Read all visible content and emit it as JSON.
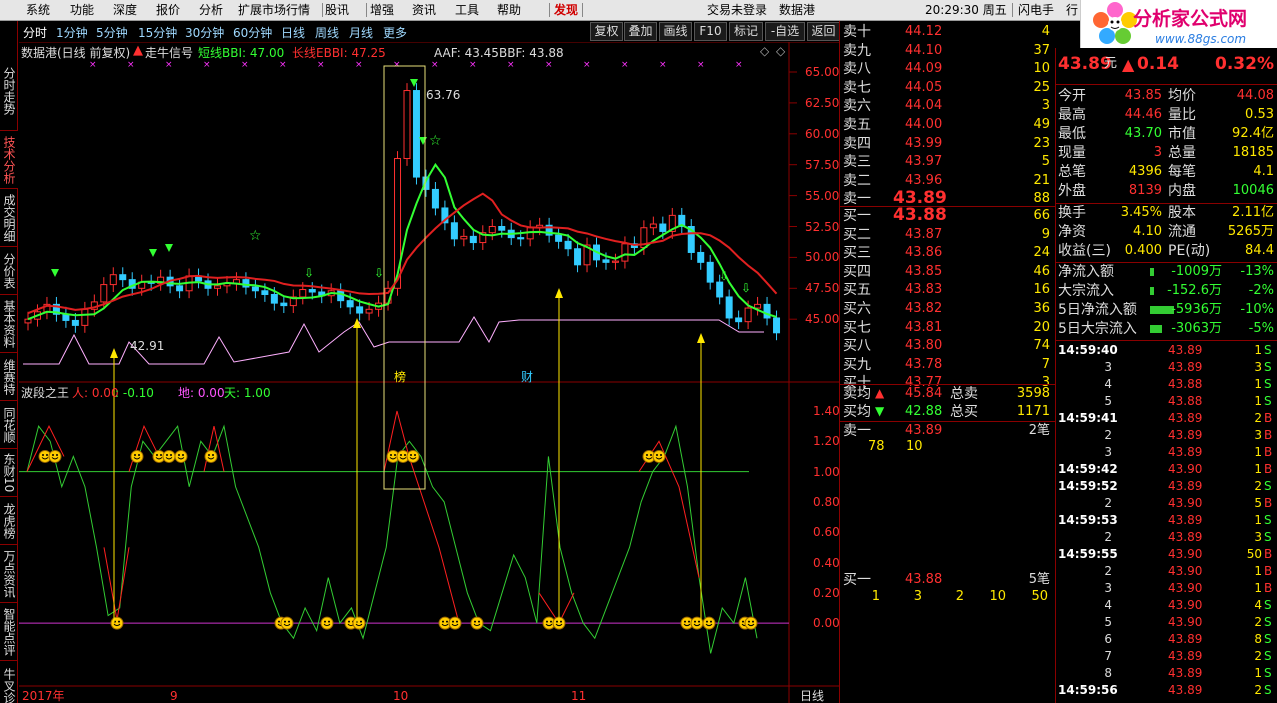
{
  "menu": [
    "系统",
    "功能",
    "深度",
    "报价",
    "分析",
    "扩展市场行情",
    "股讯",
    "增强",
    "资讯",
    "工具",
    "帮助",
    "发现"
  ],
  "status": {
    "login": "交易未登录",
    "stock": "数据港",
    "time": "20:29:30 周五",
    "flash": "闪电手",
    "more": "行"
  },
  "logo": {
    "text": "分析家公式网",
    "url": "www.88gs.com"
  },
  "leftnav": [
    "分时走势",
    "技术分析",
    "成交明细",
    "分价表",
    "基本资料",
    "维赛特",
    "同花顺",
    "东财10",
    "龙虎榜",
    "万点资讯",
    "智能点评",
    "牛叉诊股"
  ],
  "timeframes": [
    "分时",
    "1分钟",
    "5分钟",
    "15分钟",
    "30分钟",
    "60分钟",
    "日线",
    "周线",
    "月线",
    "更多"
  ],
  "toolbar": [
    "复权",
    "叠加",
    "画线",
    "F10",
    "标记",
    "-自选",
    "返回"
  ],
  "main_info": {
    "title": "数据港(日线 前复权)",
    "signal": "走牛信号",
    "short_bbi": "短线BBI: 47.00",
    "long_bbi": "长线EBBI: 47.25",
    "aaf": "AAF: 43.45",
    "bbf": "BBF: 43.88"
  },
  "price_axis": [
    "65.00",
    "62.50",
    "60.00",
    "57.50",
    "55.00",
    "52.50",
    "50.00",
    "47.50",
    "45.00"
  ],
  "annotations": {
    "high": "63.76",
    "low": "42.91",
    "bang": "榜",
    "cai": "财"
  },
  "sub_info": {
    "title": "波段之王",
    "ren": "人: 0.00",
    "val2": ": -0.10",
    "di": "地: 0.00",
    "tian": "天: 1.00"
  },
  "sub_axis": [
    "1.40",
    "1.20",
    "1.00",
    "0.80",
    "0.60",
    "0.40",
    "0.20",
    "0.00"
  ],
  "date_axis": [
    "2017年",
    "9",
    "10",
    "11"
  ],
  "period_label": "日线",
  "order_book": {
    "asks": [
      {
        "label": "卖十",
        "price": "44.12",
        "vol": "4"
      },
      {
        "label": "卖九",
        "price": "44.10",
        "vol": "37"
      },
      {
        "label": "卖八",
        "price": "44.09",
        "vol": "10"
      },
      {
        "label": "卖七",
        "price": "44.05",
        "vol": "25"
      },
      {
        "label": "卖六",
        "price": "44.04",
        "vol": "3"
      },
      {
        "label": "卖五",
        "price": "44.00",
        "vol": "49"
      },
      {
        "label": "卖四",
        "price": "43.99",
        "vol": "23"
      },
      {
        "label": "卖三",
        "price": "43.97",
        "vol": "5"
      },
      {
        "label": "卖二",
        "price": "43.96",
        "vol": "21"
      },
      {
        "label": "卖一",
        "price": "43.89",
        "vol": "88"
      }
    ],
    "bids": [
      {
        "label": "买一",
        "price": "43.88",
        "vol": "66"
      },
      {
        "label": "买二",
        "price": "43.87",
        "vol": "9"
      },
      {
        "label": "买三",
        "price": "43.86",
        "vol": "24"
      },
      {
        "label": "买四",
        "price": "43.85",
        "vol": "46"
      },
      {
        "label": "买五",
        "price": "43.83",
        "vol": "16"
      },
      {
        "label": "买六",
        "price": "43.82",
        "vol": "36"
      },
      {
        "label": "买七",
        "price": "43.81",
        "vol": "20"
      },
      {
        "label": "买八",
        "price": "43.80",
        "vol": "74"
      },
      {
        "label": "买九",
        "price": "43.78",
        "vol": "7"
      },
      {
        "label": "买十",
        "price": "43.77",
        "vol": "3"
      }
    ],
    "avg_ask": {
      "label": "卖均",
      "price": "45.84",
      "total_label": "总卖",
      "total": "3598"
    },
    "avg_bid": {
      "label": "买均",
      "price": "42.88",
      "total_label": "总买",
      "total": "1171"
    },
    "ask1_detail": {
      "label": "卖一",
      "price": "43.89",
      "count": "2笔",
      "vols": [
        "78",
        "10"
      ]
    },
    "bid1_detail": {
      "label": "买一",
      "price": "43.88",
      "count": "5笔",
      "vols": [
        "1",
        "3",
        "2",
        "10",
        "50"
      ]
    }
  },
  "quote": {
    "price": "43.89",
    "unit": "元",
    "change": "0.14",
    "pct": "0.32%",
    "rows": [
      [
        "今开",
        "43.85",
        "均价",
        "44.08"
      ],
      [
        "最高",
        "44.46",
        "量比",
        "0.53"
      ],
      [
        "最低",
        "43.70",
        "市值",
        "92.4亿"
      ],
      [
        "现量",
        "3",
        "总量",
        "18185"
      ],
      [
        "总笔",
        "4396",
        "每笔",
        "4.1"
      ],
      [
        "外盘",
        "8139",
        "内盘",
        "10046"
      ]
    ],
    "rows2": [
      [
        "换手",
        "3.45%",
        "股本",
        "2.11亿"
      ],
      [
        "净资",
        "4.10",
        "流通",
        "5265万"
      ],
      [
        "收益(三)",
        "0.400",
        "PE(动)",
        "84.4"
      ]
    ],
    "flows": [
      [
        "净流入额",
        "-1009万",
        "-13%"
      ],
      [
        "大宗流入",
        "-152.6万",
        "-2%"
      ],
      [
        "5日净流入额",
        "-5936万",
        "-10%"
      ],
      [
        "5日大宗流入",
        "-3063万",
        "-5%"
      ]
    ]
  },
  "ticks": [
    {
      "t": "14:59:40",
      "p": "43.89",
      "v": "1",
      "s": "S"
    },
    {
      "t": "3",
      "p": "43.89",
      "v": "3",
      "s": "S"
    },
    {
      "t": "4",
      "p": "43.88",
      "v": "1",
      "s": "S"
    },
    {
      "t": "5",
      "p": "43.88",
      "v": "1",
      "s": "S"
    },
    {
      "t": "14:59:41",
      "p": "43.89",
      "v": "2",
      "s": "B"
    },
    {
      "t": "2",
      "p": "43.89",
      "v": "3",
      "s": "B"
    },
    {
      "t": "3",
      "p": "43.89",
      "v": "1",
      "s": "B"
    },
    {
      "t": "14:59:42",
      "p": "43.90",
      "v": "1",
      "s": "B"
    },
    {
      "t": "14:59:52",
      "p": "43.89",
      "v": "2",
      "s": "S"
    },
    {
      "t": "2",
      "p": "43.90",
      "v": "5",
      "s": "B"
    },
    {
      "t": "14:59:53",
      "p": "43.89",
      "v": "1",
      "s": "S"
    },
    {
      "t": "2",
      "p": "43.89",
      "v": "3",
      "s": "S"
    },
    {
      "t": "14:59:55",
      "p": "43.90",
      "v": "50",
      "s": "B"
    },
    {
      "t": "2",
      "p": "43.90",
      "v": "1",
      "s": "B"
    },
    {
      "t": "3",
      "p": "43.90",
      "v": "1",
      "s": "B"
    },
    {
      "t": "4",
      "p": "43.90",
      "v": "4",
      "s": "S"
    },
    {
      "t": "5",
      "p": "43.90",
      "v": "2",
      "s": "S"
    },
    {
      "t": "6",
      "p": "43.89",
      "v": "8",
      "s": "S"
    },
    {
      "t": "7",
      "p": "43.89",
      "v": "2",
      "s": "S"
    },
    {
      "t": "8",
      "p": "43.89",
      "v": "1",
      "s": "S"
    },
    {
      "t": "14:59:56",
      "p": "43.89",
      "v": "2",
      "s": "S"
    }
  ]
}
